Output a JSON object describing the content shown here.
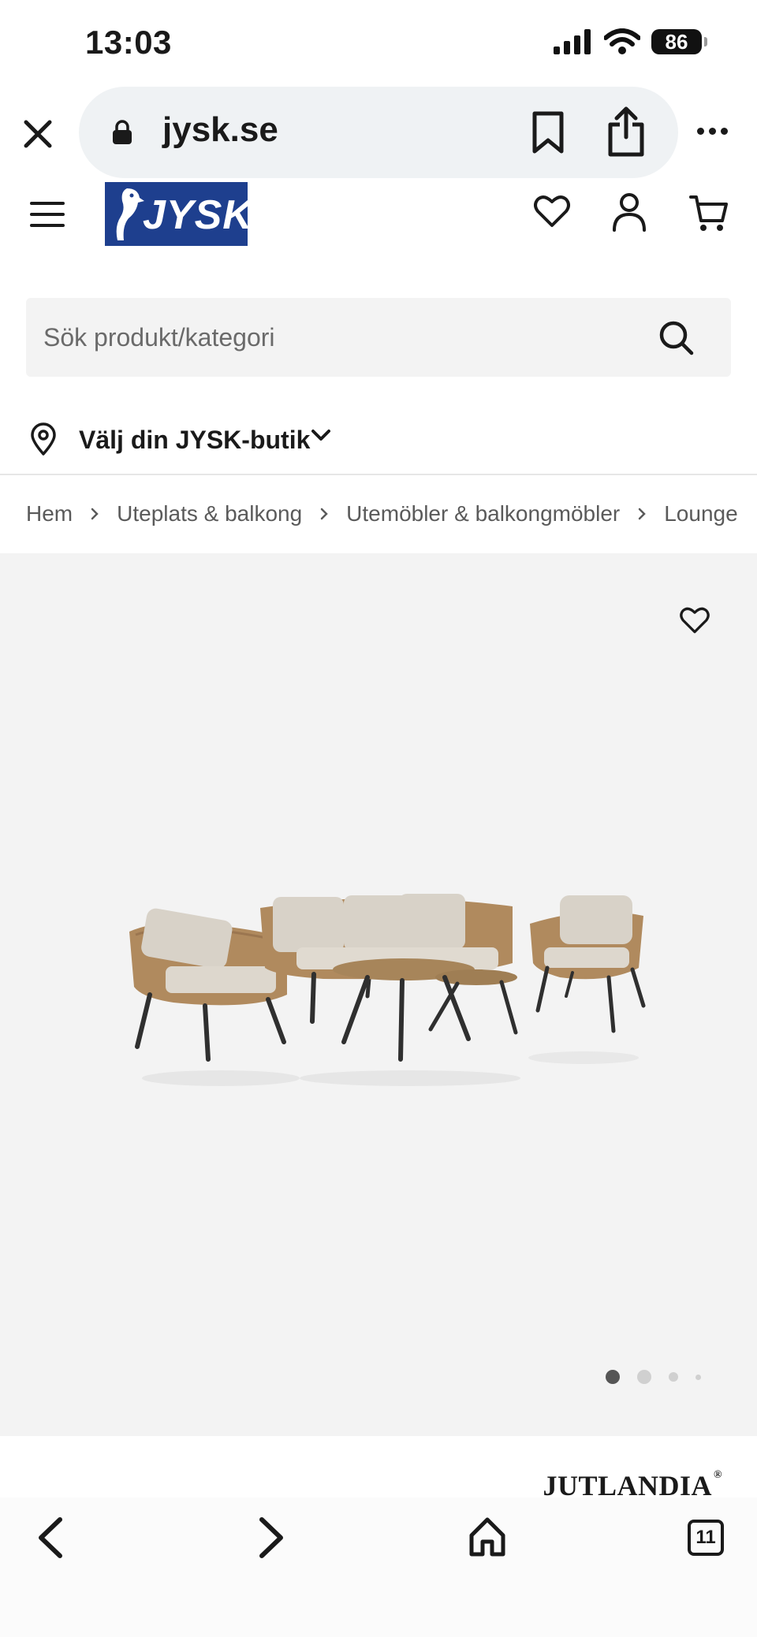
{
  "status_bar": {
    "time": "13:03",
    "battery": "86"
  },
  "browser": {
    "url": "jysk.se"
  },
  "site": {
    "logo_text": "JYSK"
  },
  "search": {
    "placeholder": "Sök produkt/kategori"
  },
  "store": {
    "label": "Välj din JYSK-butik"
  },
  "breadcrumb": {
    "items": [
      "Hem",
      "Uteplats & balkong",
      "Utemöbler & balkongmöbler",
      "Lounge"
    ]
  },
  "gallery": {
    "image_count": 4,
    "active_index": 1
  },
  "product": {
    "brand": "JUTLANDIA",
    "brand_mark": "®"
  },
  "bottom_nav": {
    "tab_count": "11"
  },
  "colors": {
    "brand_blue": "#1e3f8e",
    "gallery_bg": "#f3f3f3",
    "url_bar_bg": "#eff2f4",
    "text": "#1a1a1a"
  },
  "icons": [
    "close-icon",
    "lock-icon",
    "bookmark-icon",
    "share-icon",
    "more-icon",
    "menu-icon",
    "heart-icon",
    "user-icon",
    "cart-icon",
    "search-icon",
    "location-pin-icon",
    "chevron-down-icon",
    "chevron-right-icon",
    "back-icon",
    "forward-icon",
    "home-icon",
    "tabs-icon"
  ]
}
